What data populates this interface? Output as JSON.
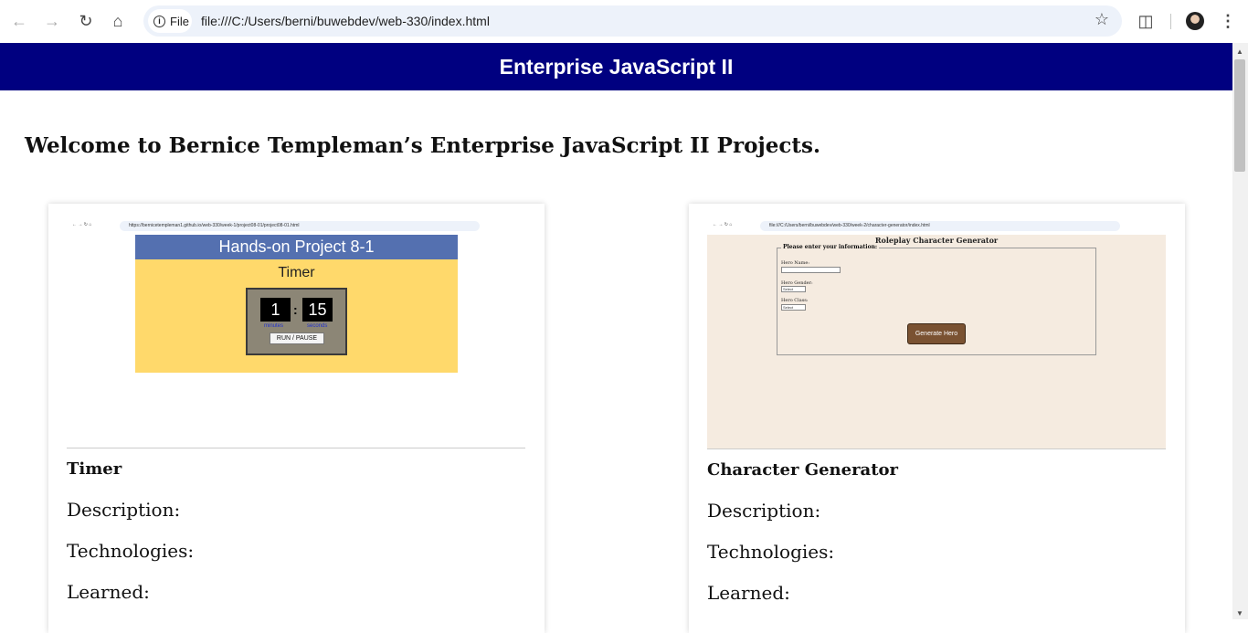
{
  "browser": {
    "chip_label": "File",
    "url": "file:///C:/Users/berni/buwebdev/web-330/index.html"
  },
  "header": {
    "title": "Enterprise JavaScript II"
  },
  "welcome": "Welcome to Bernice Templeman’s Enterprise JavaScript II Projects.",
  "cards": [
    {
      "thumb_url": "https://bernicetempleman1.github.io/web-330/week-1/project08-01/project08-01.html",
      "preview": {
        "heading": "Hands-on Project 8-1",
        "title": "Timer",
        "minutes": "1",
        "seconds": "15",
        "minutes_label": "minutes",
        "seconds_label": "seconds",
        "button": "RUN / PAUSE"
      },
      "title": "Timer",
      "description": "Description:",
      "technologies": "Technologies:",
      "learned": "Learned:"
    },
    {
      "thumb_url": "file:///C:/Users/berni/buwebdev/web-330/week-2/character-generator/index.html",
      "preview": {
        "heading": "Roleplay Character Generator",
        "legend": "Please enter your information:",
        "name_label": "Hero Name:",
        "gender_label": "Hero Gender:",
        "class_label": "Hero Class:",
        "select": "Select",
        "button": "Generate Hero"
      },
      "title": "Character Generator",
      "description": "Description:",
      "technologies": "Technologies:",
      "learned": "Learned:"
    }
  ]
}
